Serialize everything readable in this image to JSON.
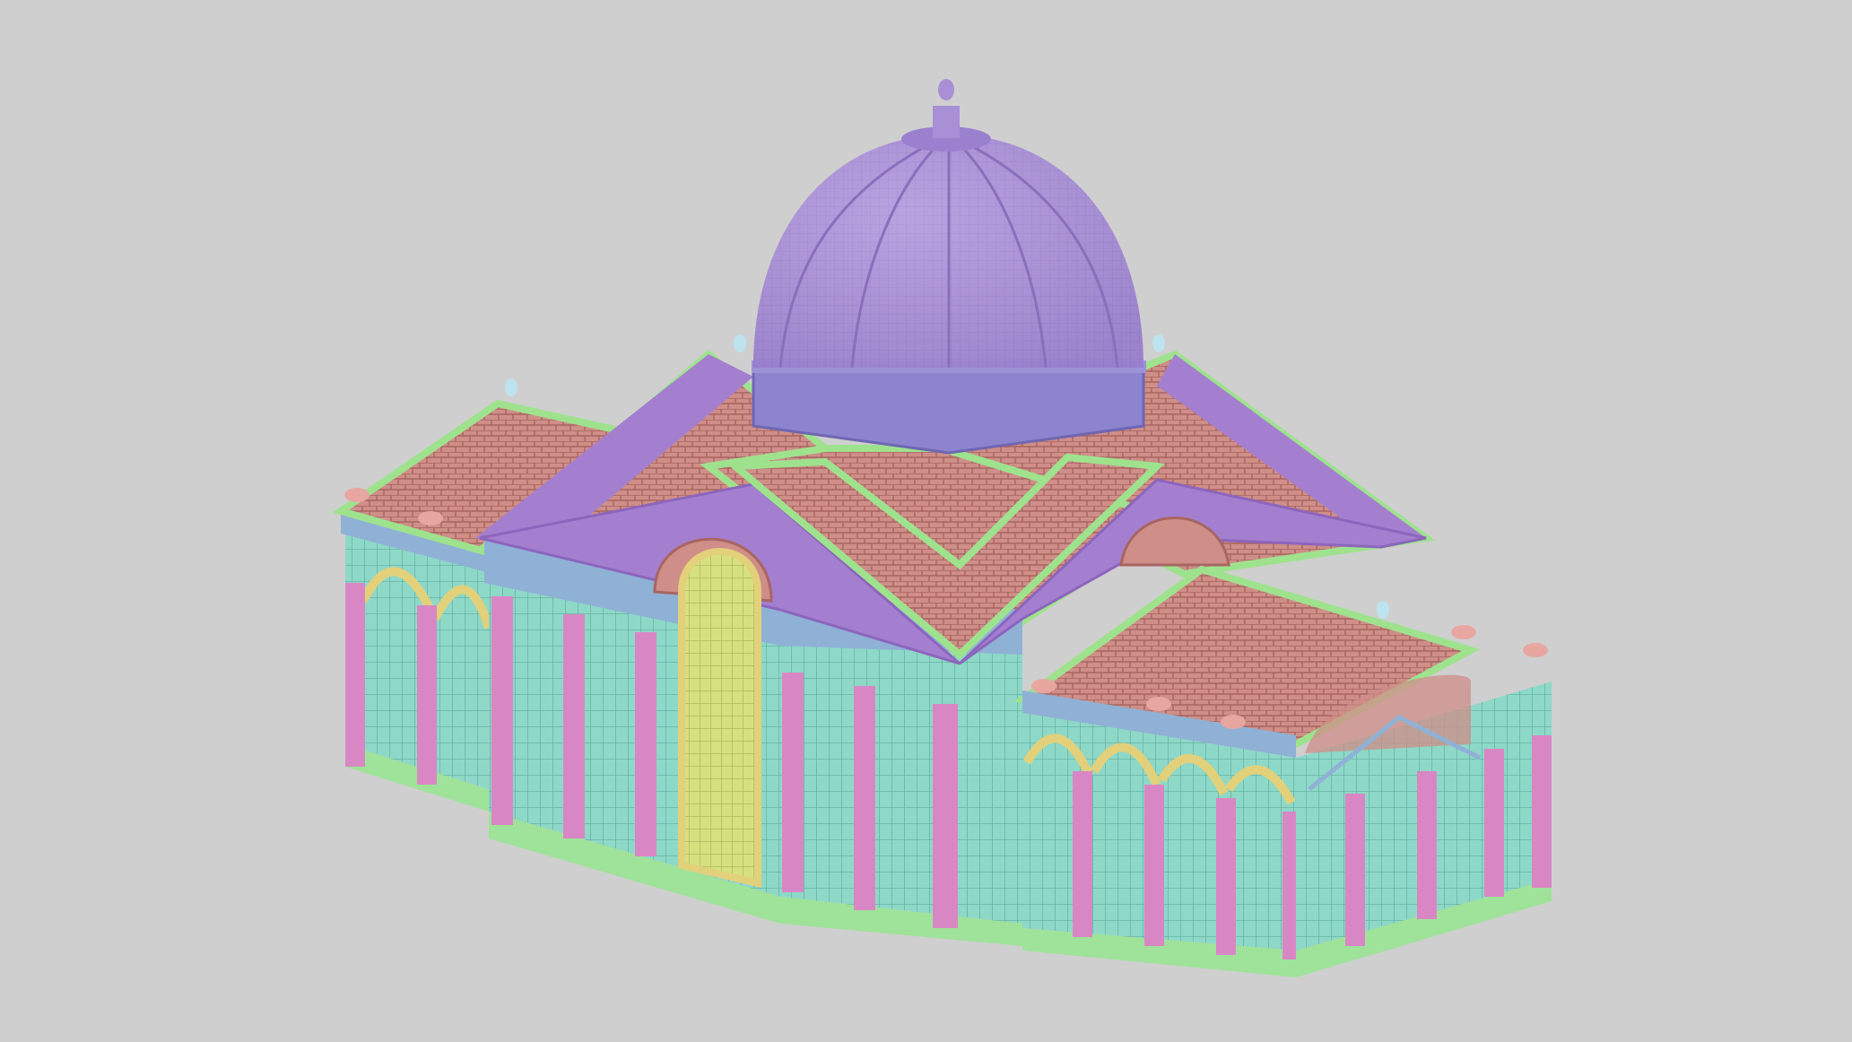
{
  "scene": {
    "subject": "conservatory",
    "colors": {
      "background": "#cfcfcf",
      "dome": "#a98fd6",
      "dome_dark": "#8f77c2",
      "drum": "#8d84cf",
      "roof_tile": "#cf8e88",
      "roof_tile_dark": "#b9736f",
      "roof_frame": "#9ee28e",
      "pediment": "#a57fcf",
      "cornice": "#8fb1d6",
      "wall_glass": "#8ed8c8",
      "pilaster": "#d987c4",
      "base": "#9fe29a",
      "arch_trim": "#e2d07a",
      "door": "#d6e07e",
      "urn": "#e7a7a0",
      "finial": "#bde3ef"
    }
  }
}
